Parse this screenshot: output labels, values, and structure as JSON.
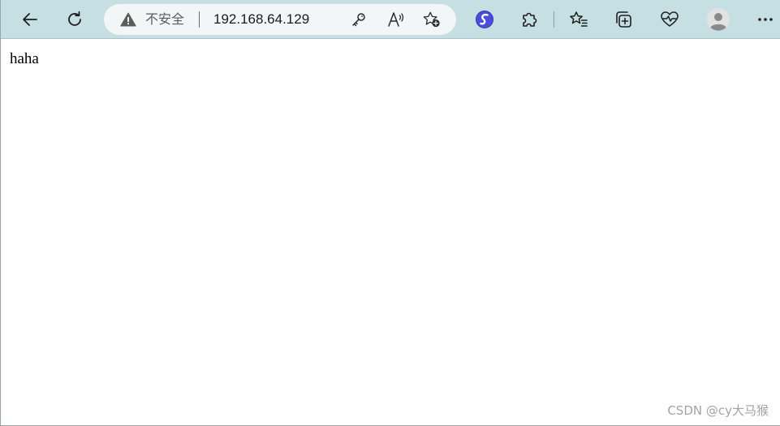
{
  "browser": {
    "address_bar": {
      "security_label": "不安全",
      "url": "192.168.64.129"
    },
    "icons": {
      "back": "back-arrow-icon",
      "refresh": "refresh-icon",
      "warning": "warning-triangle-icon",
      "password": "key-icon",
      "read_aloud": "read-aloud-icon",
      "add_favorite": "add-favorite-star-icon",
      "extension_logo": "s-logo-icon",
      "extensions": "puzzle-icon",
      "favorites": "favorites-list-icon",
      "collections": "collections-icon",
      "browser_essentials": "heart-pulse-icon",
      "profile": "profile-avatar-icon",
      "more": "ellipsis-icon"
    },
    "colors": {
      "toolbar": "#c6dfe3",
      "address_bar": "#f3f6f6",
      "extension_logo": "#4a4ed8"
    }
  },
  "page": {
    "body_text": "haha",
    "watermark": "CSDN @cy大马猴"
  }
}
